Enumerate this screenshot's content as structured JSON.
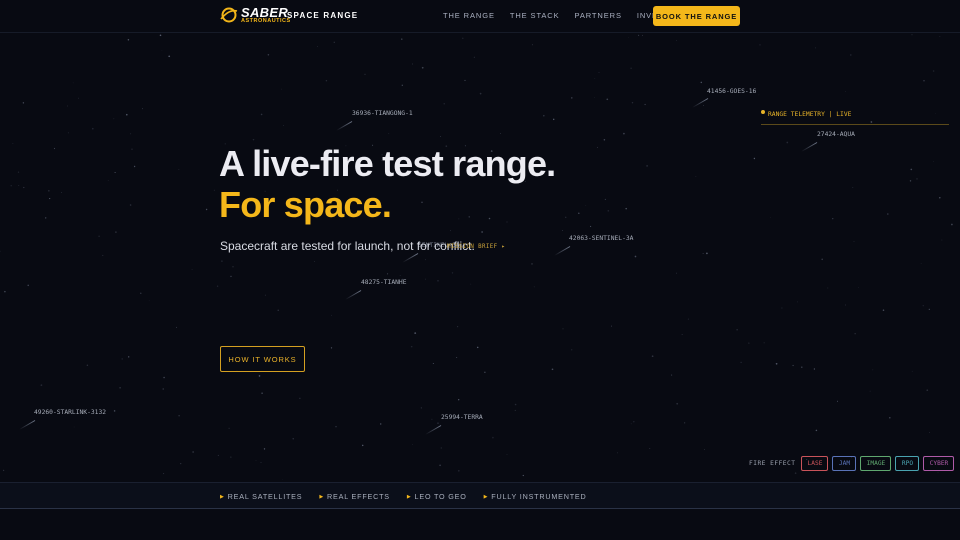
{
  "nav": {
    "logo_main": "SABER",
    "logo_sub": "ASTRONAUTICS",
    "product": "SPACE RANGE",
    "links": [
      "THE RANGE",
      "THE STACK",
      "PARTNERS",
      "INVESTORS"
    ],
    "cta": "BOOK THE RANGE"
  },
  "satellites": [
    {
      "label": "41456-GOES-16"
    },
    {
      "label": "36936-TIANGONG-1"
    },
    {
      "label": "27424-AQUA"
    },
    {
      "label": "42063-SENTINEL-3A"
    },
    {
      "label": "SENTINEL-3A"
    },
    {
      "label": "48275-TIANHE"
    },
    {
      "label": "49260-STARLINK-3132"
    },
    {
      "label": "25994-TERRA"
    }
  ],
  "telemetry": "RANGE TELEMETRY | LIVE",
  "hero": {
    "line1": "A live-fire test range.",
    "line2": "For space.",
    "subtitle": "Spacecraft are tested for launch, not for conflict.",
    "brief": "MISSION BRIEF ▸",
    "cta": "HOW IT WORKS"
  },
  "fire_effect": {
    "label": "FIRE EFFECT",
    "chips": [
      {
        "label": "LASE",
        "color": "#c9535a"
      },
      {
        "label": "JAM",
        "color": "#5a73b8"
      },
      {
        "label": "IMAGE",
        "color": "#5fa86f"
      },
      {
        "label": "RPO",
        "color": "#4aa3b0"
      },
      {
        "label": "CYBER",
        "color": "#b05aa8"
      }
    ]
  },
  "strip": [
    "REAL SATELLITES",
    "REAL EFFECTS",
    "LEO TO GEO",
    "FULLY INSTRUMENTED"
  ],
  "colors": {
    "accent": "#f4b71a",
    "background": "#080a12"
  }
}
